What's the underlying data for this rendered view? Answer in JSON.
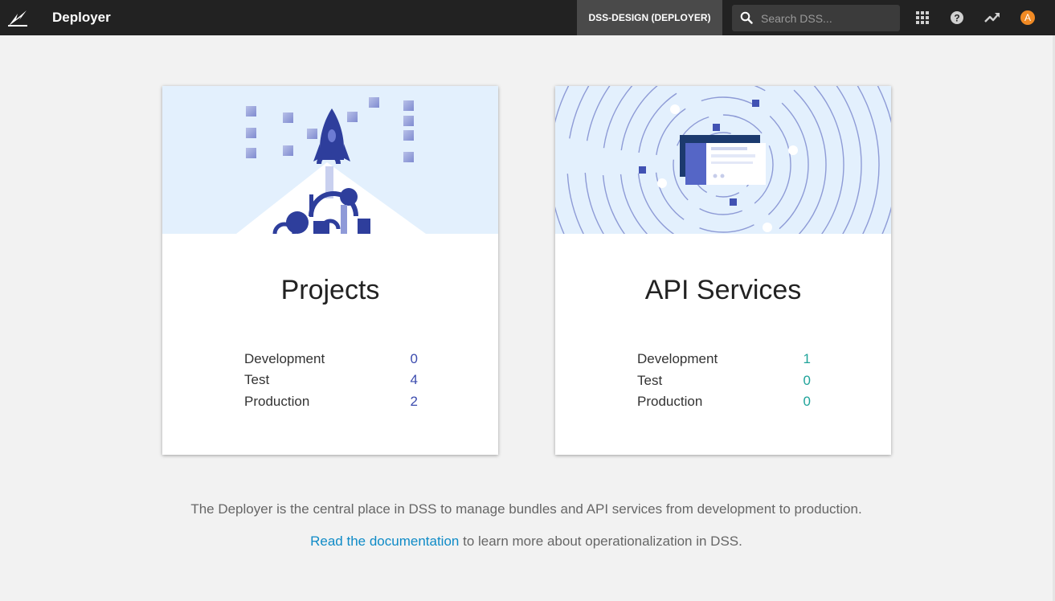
{
  "header": {
    "app_title": "Deployer",
    "instance_label": "DSS-DESIGN (DEPLOYER)",
    "search_placeholder": "Search DSS...",
    "avatar_initial": "A",
    "icons": [
      "logo-icon",
      "search-icon",
      "apps-grid-icon",
      "help-icon",
      "trends-icon"
    ]
  },
  "cards": [
    {
      "title": "Projects",
      "value_color": "#3b4bae",
      "stats": [
        {
          "label": "Development",
          "value": "0"
        },
        {
          "label": "Test",
          "value": "4"
        },
        {
          "label": "Production",
          "value": "2"
        }
      ]
    },
    {
      "title": "API Services",
      "value_color": "#1fa39a",
      "stats": [
        {
          "label": "Development",
          "value": "1"
        },
        {
          "label": "Test",
          "value": "0"
        },
        {
          "label": "Production",
          "value": "0"
        }
      ]
    }
  ],
  "footer": {
    "description": "The Deployer is the central place in DSS to manage bundles and API services from development to production.",
    "doc_link": "Read the documentation",
    "doc_suffix": " to learn more about operationalization in DSS."
  },
  "colors": {
    "topbar": "#222222",
    "illustration_bg": "#e3f0fd",
    "accent_blue": "#3b4bae",
    "accent_teal": "#1fa39a",
    "link": "#0f8bc7"
  }
}
